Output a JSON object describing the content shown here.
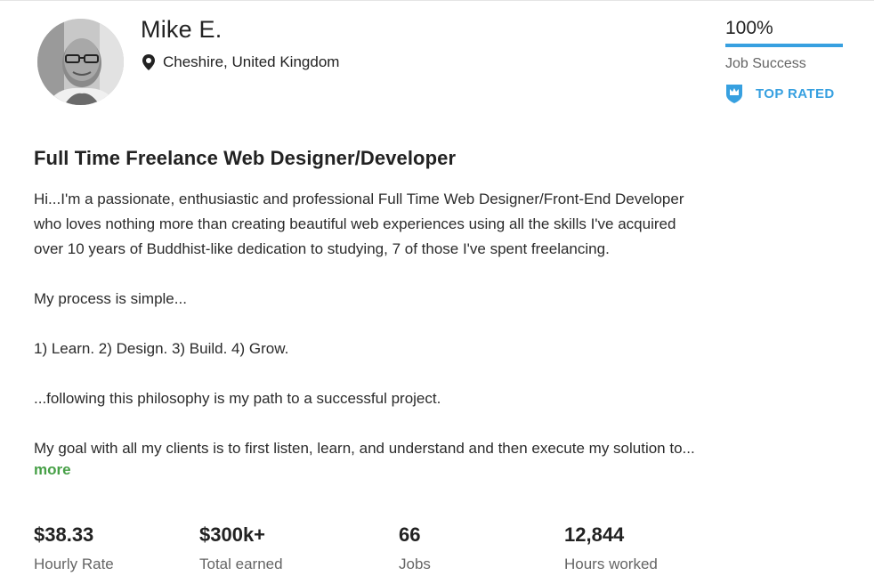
{
  "profile": {
    "name": "Mike E.",
    "location": "Cheshire, United Kingdom",
    "location_icon": "map-pin-icon",
    "avatar_desc": "profile photo"
  },
  "job_success": {
    "value": "100%",
    "fraction": 1.0,
    "label": "Job Success",
    "badge": "TOP RATED",
    "badge_icon": "top-rated-shield-icon",
    "accent_color": "#37a0e0"
  },
  "overview": {
    "title": "Full Time Freelance Web Designer/Developer",
    "lines": [
      "Hi...I'm a passionate, enthusiastic and professional Full Time Web Designer/Front-End Developer",
      "who loves nothing more than creating beautiful web experiences using all the skills I've acquired",
      "over 10 years of Buddhist-like dedication to studying, 7 of those I've spent freelancing."
    ],
    "paragraphs": [
      "My process is simple...",
      "1) Learn. 2) Design. 3) Build. 4) Grow.",
      "...following this philosophy is my path to a successful project.",
      "My goal with all my clients is to first listen, learn, and understand and then execute my solution to..."
    ],
    "more_label": "more",
    "more_color": "#47a047"
  },
  "stats": [
    {
      "value": "$38.33",
      "label": "Hourly Rate"
    },
    {
      "value": "$300k+",
      "label": "Total earned"
    },
    {
      "value": "66",
      "label": "Jobs"
    },
    {
      "value": "12,844",
      "label": "Hours worked"
    }
  ]
}
